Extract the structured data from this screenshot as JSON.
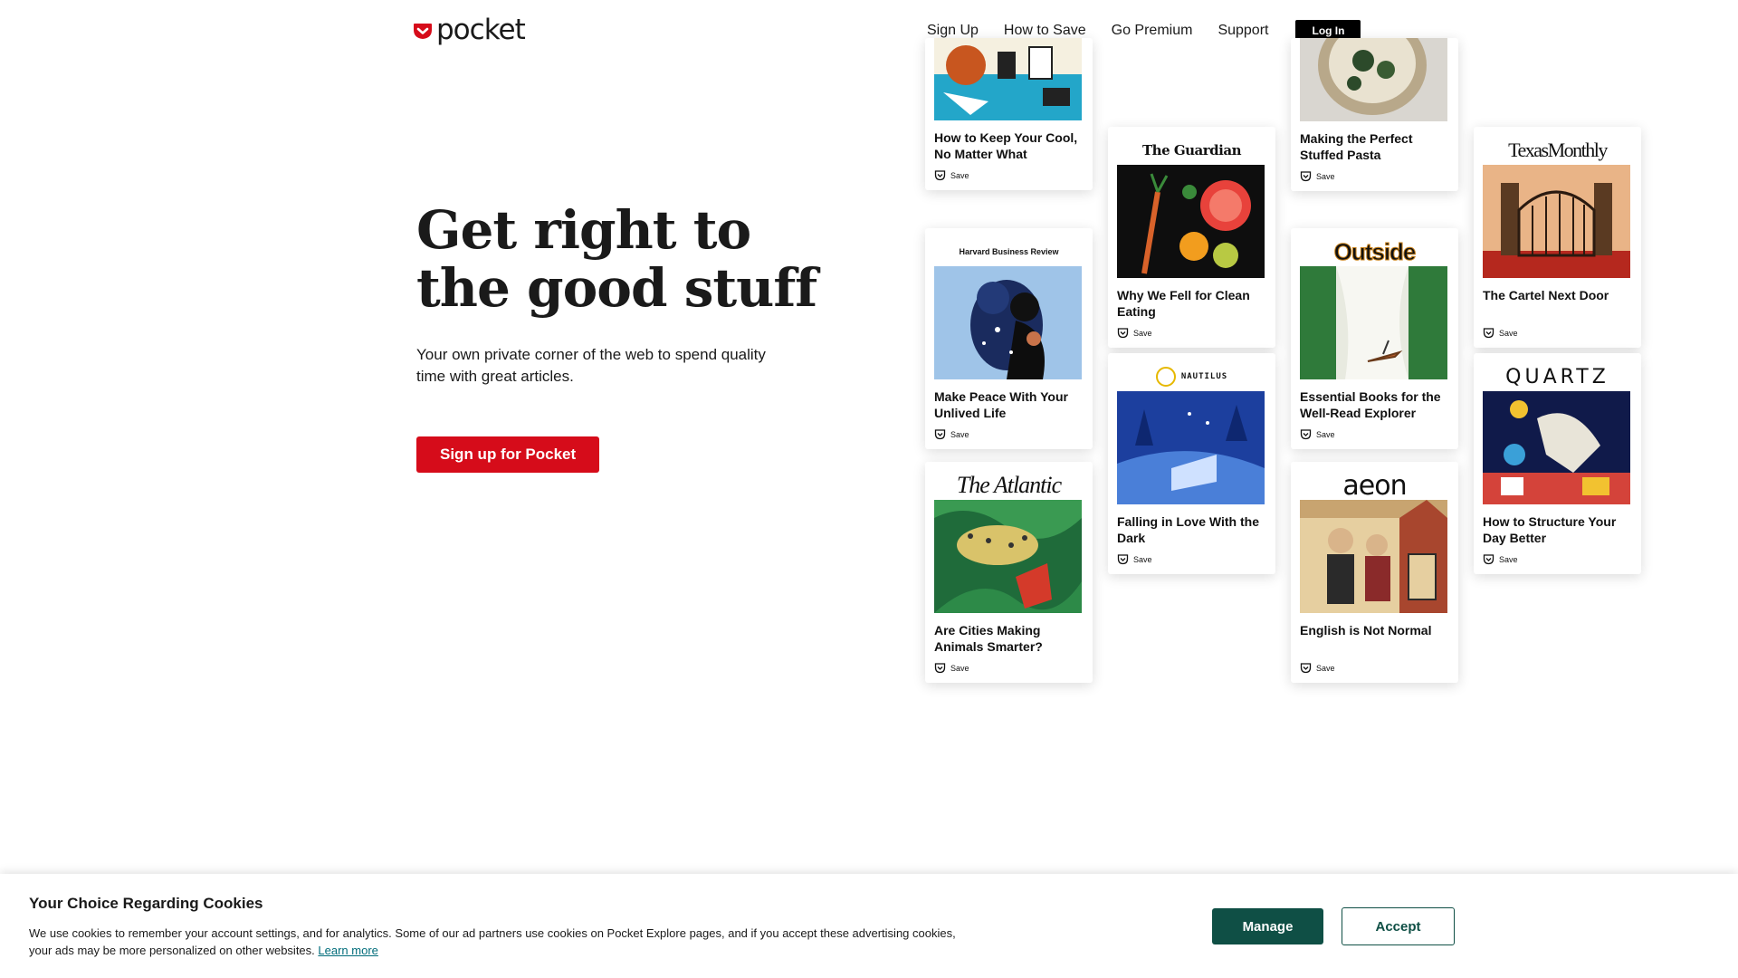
{
  "brand": {
    "name": "pocket",
    "accent": "#d60c1a"
  },
  "nav": {
    "items": [
      "Sign Up",
      "How to Save",
      "Go Premium",
      "Support"
    ],
    "login_label": "Log In"
  },
  "hero": {
    "title_line1": "Get right to",
    "title_line2": "the good stuff",
    "subtitle": "Your own private corner of the web to spend quality time with great articles.",
    "cta_label": "Sign up for Pocket"
  },
  "cards": {
    "save_label": "Save",
    "keep_cool": {
      "title": "How to Keep Your Cool, No Matter What"
    },
    "make_peace": {
      "publisher": "Harvard Business Review",
      "title": "Make Peace With Your Unlived Life"
    },
    "cities": {
      "publisher": "The Atlantic",
      "title": "Are Cities Making Animals Smarter?"
    },
    "clean_eating": {
      "publisher": "The Guardian",
      "title": "Why We Fell for Clean Eating"
    },
    "in_love": {
      "publisher": "NAUTILUS",
      "title": "Falling in Love With the Dark"
    },
    "pasta": {
      "title": "Making the Perfect Stuffed Pasta"
    },
    "books": {
      "publisher": "Outside",
      "title": "Essential Books for the Well-Read Explorer"
    },
    "english": {
      "publisher": "aeon",
      "title": "English is Not Normal"
    },
    "cartel": {
      "publisher": "TexasMonthly",
      "title": "The Cartel Next Door"
    },
    "structure": {
      "publisher": "QUARTZ",
      "title": "How to Structure Your Day Better"
    }
  },
  "cookie": {
    "title": "Your Choice Regarding Cookies",
    "text": "We use cookies to remember your account settings, and for analytics. Some of our ad partners use cookies on Pocket Explore pages, and if you accept these advertising cookies, your ads may be more personalized on other websites.",
    "learn_more": "Learn more",
    "manage_label": "Manage",
    "accept_label": "Accept"
  }
}
